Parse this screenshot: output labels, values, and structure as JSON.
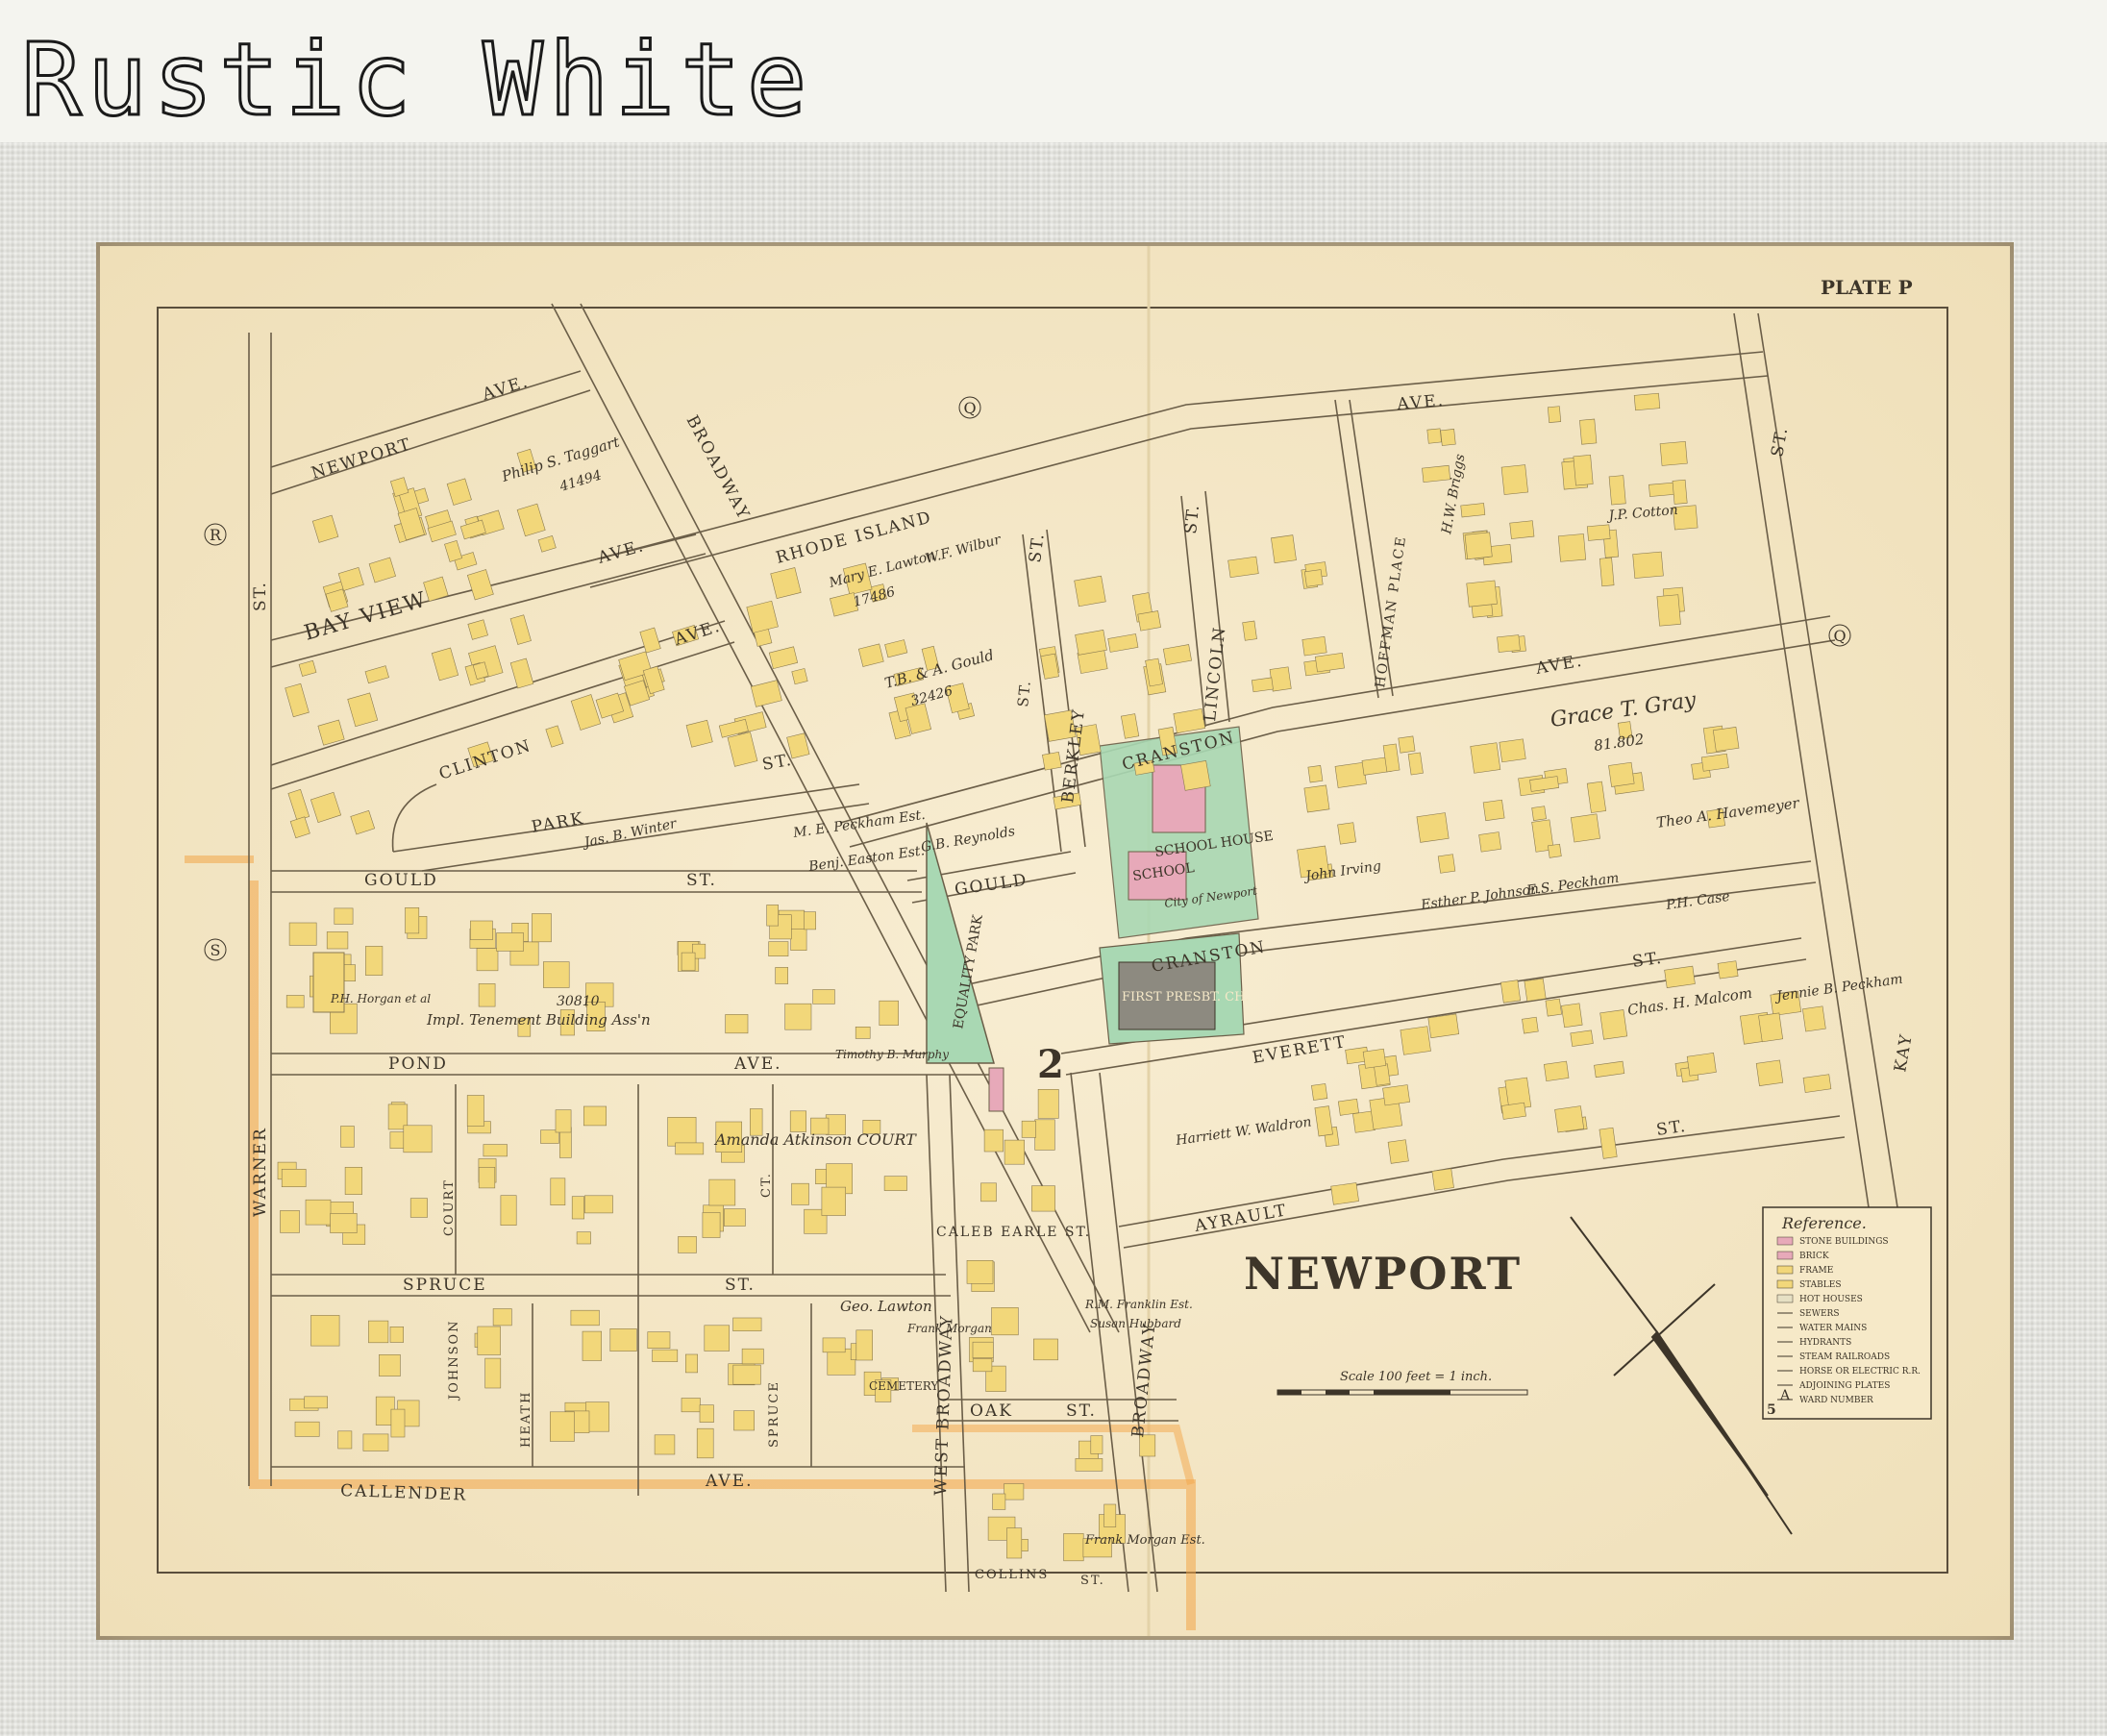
{
  "header": {
    "title": "Rustic White"
  },
  "map": {
    "plate": "PLATE P",
    "city": "NEWPORT",
    "ward_number": "2",
    "scale": "Scale 100 feet = 1 inch.",
    "adjoining": [
      "Q",
      "Q",
      "R",
      "S"
    ],
    "streets": {
      "newport_ave": "NEWPORT",
      "ave_top": "AVE.",
      "broadway": "BROADWAY",
      "rhode_island": "RHODE ISLAND",
      "ave_right": "AVE.",
      "bay_view": "BAY VIEW",
      "bay_view_ave": "AVE.",
      "clinton": "CLINTON",
      "clinton_ave": "AVE.",
      "park": "PARK",
      "park_st": "ST.",
      "gould": "GOULD",
      "gould_st": "ST.",
      "gould_right": "GOULD",
      "pond": "POND",
      "pond_ave": "AVE.",
      "spruce": "SPRUCE",
      "spruce_st": "ST.",
      "callender": "CALLENDER",
      "callender_ave": "AVE.",
      "warner": "WARNER",
      "st_left": "ST.",
      "court": "COURT",
      "heath": "HEATH",
      "johnson": "JOHNSON",
      "spruce_ct": "SPRUCE",
      "ct": "CT.",
      "west_broadway": "WEST BROADWAY",
      "broadway_lower": "BROADWAY",
      "berkley": "BERKLEY",
      "berkley_st": "ST.",
      "lincoln": "LINCOLN",
      "lincoln_st": "ST.",
      "hoffman": "HOFFMAN PLACE",
      "cranston_upper": "CRANSTON",
      "cranston_ave": "AVE.",
      "cranston_lower": "CRANSTON",
      "everett": "EVERETT",
      "everett_st": "ST.",
      "ayrault": "AYRAULT",
      "ayrault_st": "ST.",
      "kay": "KAY",
      "kay_st": "ST.",
      "oak": "OAK",
      "oak_st": "ST.",
      "collins": "COLLINS",
      "collins_st": "ST.",
      "caleb_earle": "CALEB EARLE ST.",
      "st_top": "ST."
    },
    "landmarks": {
      "equality_park": "EQUALITY PARK",
      "school_house": "SCHOOL HOUSE",
      "school": "SCHOOL",
      "first_presbt": "FIRST PRESBT. CH.",
      "cemetery": "CEMETERY",
      "amanda": "Amanda Atkinson COURT"
    },
    "owners": [
      {
        "text": "Philip S. Taggart"
      },
      {
        "text": "41494"
      },
      {
        "text": "Mary E. Lawton"
      },
      {
        "text": "17486"
      },
      {
        "text": "W.F. Wilbur"
      },
      {
        "text": "T.B. & A. Gould"
      },
      {
        "text": "32426"
      },
      {
        "text": "Grace T. Gray"
      },
      {
        "text": "81.802"
      },
      {
        "text": "Theo A. Havemeyer"
      },
      {
        "text": "Chas. H. Malcom"
      },
      {
        "text": "Jennie B. Peckham"
      },
      {
        "text": "M. E. Peckham Est."
      },
      {
        "text": "Benj. Easton Est."
      },
      {
        "text": "Jas. B. Winter"
      },
      {
        "text": "Impl. Tenement Building Ass'n"
      },
      {
        "text": "30810"
      },
      {
        "text": "P.H. Horgan et al"
      },
      {
        "text": "G.B. Reynolds"
      },
      {
        "text": "City of Newport"
      },
      {
        "text": "Esther P. Johnson"
      },
      {
        "text": "E.S. Peckham"
      },
      {
        "text": "P.H. Case"
      },
      {
        "text": "J.P. Cotton"
      },
      {
        "text": "H.W. Briggs"
      },
      {
        "text": "John Irving"
      },
      {
        "text": "Geo. Lawton"
      },
      {
        "text": "Frank Morgan Est."
      },
      {
        "text": "Harriett W. Waldron"
      },
      {
        "text": "Timothy B. Murphy"
      },
      {
        "text": "Frank Morgan"
      },
      {
        "text": "R.M. Franklin Est."
      },
      {
        "text": "Susan Hubbard"
      }
    ],
    "legend": {
      "title": "Reference.",
      "items": [
        {
          "label": "STONE BUILDINGS",
          "color": "#e7a9b9"
        },
        {
          "label": "BRICK",
          "color": "#e7a9b9"
        },
        {
          "label": "FRAME",
          "color": "#f2d77a"
        },
        {
          "label": "STABLES",
          "color": "#f2d77a"
        },
        {
          "label": "HOT HOUSES",
          "color": "#e6e0c4"
        },
        {
          "label": "SEWERS",
          "color": ""
        },
        {
          "label": "WATER MAINS",
          "color": ""
        },
        {
          "label": "HYDRANTS",
          "color": ""
        },
        {
          "label": "STEAM RAILROADS",
          "color": ""
        },
        {
          "label": "HORSE OR ELECTRIC R.R.",
          "color": ""
        },
        {
          "label": "ADJOINING PLATES",
          "color": ""
        },
        {
          "label": "WARD NUMBER",
          "color": ""
        }
      ],
      "adjoining_symbol": "A",
      "ward_symbol": "5"
    },
    "colors": {
      "paper": "#f6e9c8",
      "building": "#f2d77a",
      "park": "#a9d8b3",
      "brick": "#e7a9b9",
      "boundary": "#f3a548",
      "ink": "#3d3529"
    }
  }
}
